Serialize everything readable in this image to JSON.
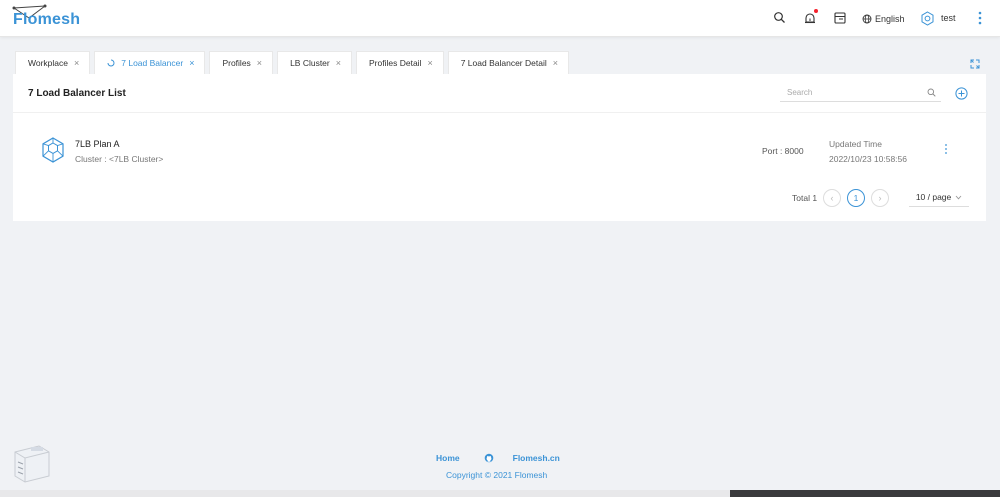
{
  "app": {
    "logo_text": "Flomesh",
    "language": "English",
    "username": "test"
  },
  "tabs": [
    {
      "label": "Workplace",
      "active": false
    },
    {
      "label": "7 Load Balancer",
      "active": true
    },
    {
      "label": "Profiles",
      "active": false
    },
    {
      "label": "LB Cluster",
      "active": false
    },
    {
      "label": "Profiles Detail",
      "active": false
    },
    {
      "label": "7 Load Balancer Detail",
      "active": false
    }
  ],
  "tab_close_glyph": "×",
  "main": {
    "title": "7 Load Balancer List",
    "search_placeholder": "Search",
    "items": [
      {
        "name": "7LB Plan A",
        "cluster": "Cluster : <7LB Cluster>",
        "port": "Port : 8000",
        "updated_label": "Updated Time",
        "updated_value": "2022/10/23 10:58:56"
      }
    ],
    "pagination": {
      "total": "Total 1",
      "prev": "‹",
      "current_page": "1",
      "next": "›",
      "page_size": "10 / page"
    }
  },
  "footer": {
    "home": "Home",
    "site": "Flomesh.cn",
    "copyright": "Copyright © 2021 Flomesh"
  },
  "colors": {
    "accent": "#3b93d6",
    "background": "#f0f2f5",
    "notification": "#f5222d"
  }
}
